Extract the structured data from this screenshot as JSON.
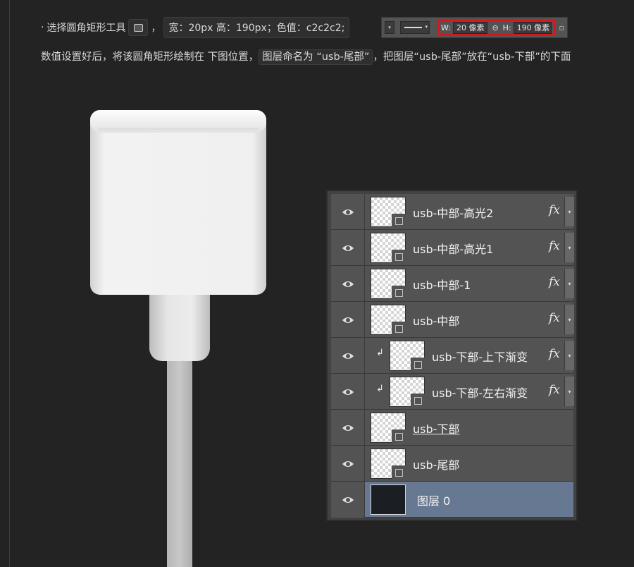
{
  "instruction": {
    "bullet": "·",
    "select_prefix": "选择圆角矩形工具",
    "specs": "宽：20px 高：190px；色值：c2c2c2;",
    "comma": "，",
    "paragraph": {
      "part1": "数值设置好后，将该圆角矩形绘制在 下图位置，",
      "highlight": "图层命名为 “usb-尾部”",
      "part2": "，把图层“usb-尾部”放在“usb-下部”的下面"
    }
  },
  "options_bar": {
    "width_label": "W:",
    "width_value": "20 像素",
    "link_icon": "link-icon",
    "height_label": "H:",
    "height_value": "190 像素",
    "highlight_color": "#d5161b"
  },
  "layers_panel": {
    "selected_color": "#677892",
    "layers": [
      {
        "name": "usb-中部-高光2",
        "fx": "fx"
      },
      {
        "name": "usb-中部-高光1",
        "fx": "fx"
      },
      {
        "name": "usb-中部-1",
        "fx": "fx"
      },
      {
        "name": "usb-中部",
        "fx": "fx"
      },
      {
        "name": "usb-下部-上下渐变",
        "fx": "fx",
        "clip_icon": "↲"
      },
      {
        "name": "usb-下部-左右渐变",
        "fx": "fx",
        "clip_icon": "↲"
      },
      {
        "name": "usb-下部"
      },
      {
        "name": "usb-尾部"
      },
      {
        "name": "图层 0"
      }
    ]
  },
  "colors": {
    "background": "#232323",
    "tail_color": "#c2c2c2"
  }
}
